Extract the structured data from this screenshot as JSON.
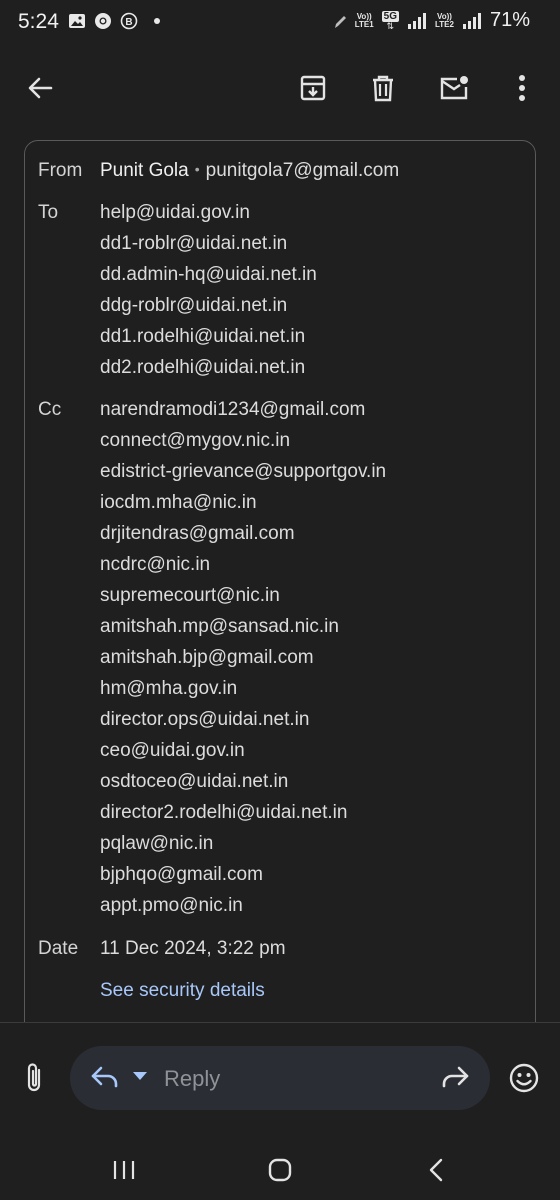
{
  "status_bar": {
    "time": "5:24",
    "battery": "71%",
    "sim1_top": "Vo))",
    "sim1_bottom": "LTE1",
    "net": "5G",
    "sim2_top": "Vo))",
    "sim2_bottom": "LTE2"
  },
  "toolbar": {
    "back": "back-arrow-icon",
    "archive": "archive-icon",
    "delete": "trash-icon",
    "unread": "mark-unread-icon",
    "more": "more-vert-icon"
  },
  "details": {
    "from_label": "From",
    "from_name": "Punit Gola",
    "from_sep": "•",
    "from_email": "punitgola7@gmail.com",
    "to_label": "To",
    "to": [
      "help@uidai.gov.in",
      "dd1-roblr@uidai.net.in",
      "dd.admin-hq@uidai.net.in",
      "ddg-roblr@uidai.net.in",
      "dd1.rodelhi@uidai.net.in",
      "dd2.rodelhi@uidai.net.in"
    ],
    "cc_label": "Cc",
    "cc": [
      "narendramodi1234@gmail.com",
      "connect@mygov.nic.in",
      "edistrict-grievance@supportgov.in",
      "iocdm.mha@nic.in",
      "drjitendras@gmail.com",
      "ncdrc@nic.in",
      "supremecourt@nic.in",
      "amitshah.mp@sansad.nic.in",
      "amitshah.bjp@gmail.com",
      "hm@mha.gov.in",
      "director.ops@uidai.net.in",
      "ceo@uidai.gov.in",
      "osdtoceo@uidai.net.in",
      "director2.rodelhi@uidai.net.in",
      "pqlaw@nic.in",
      "bjphqo@gmail.com",
      "appt.pmo@nic.in"
    ],
    "date_label": "Date",
    "date": "11 Dec 2024, 3:22 pm",
    "security_link": "See security details"
  },
  "reply_bar": {
    "placeholder": "Reply"
  },
  "colors": {
    "background": "#1f1f1f",
    "link": "#a8c7fa",
    "pill": "#2a2d34"
  }
}
